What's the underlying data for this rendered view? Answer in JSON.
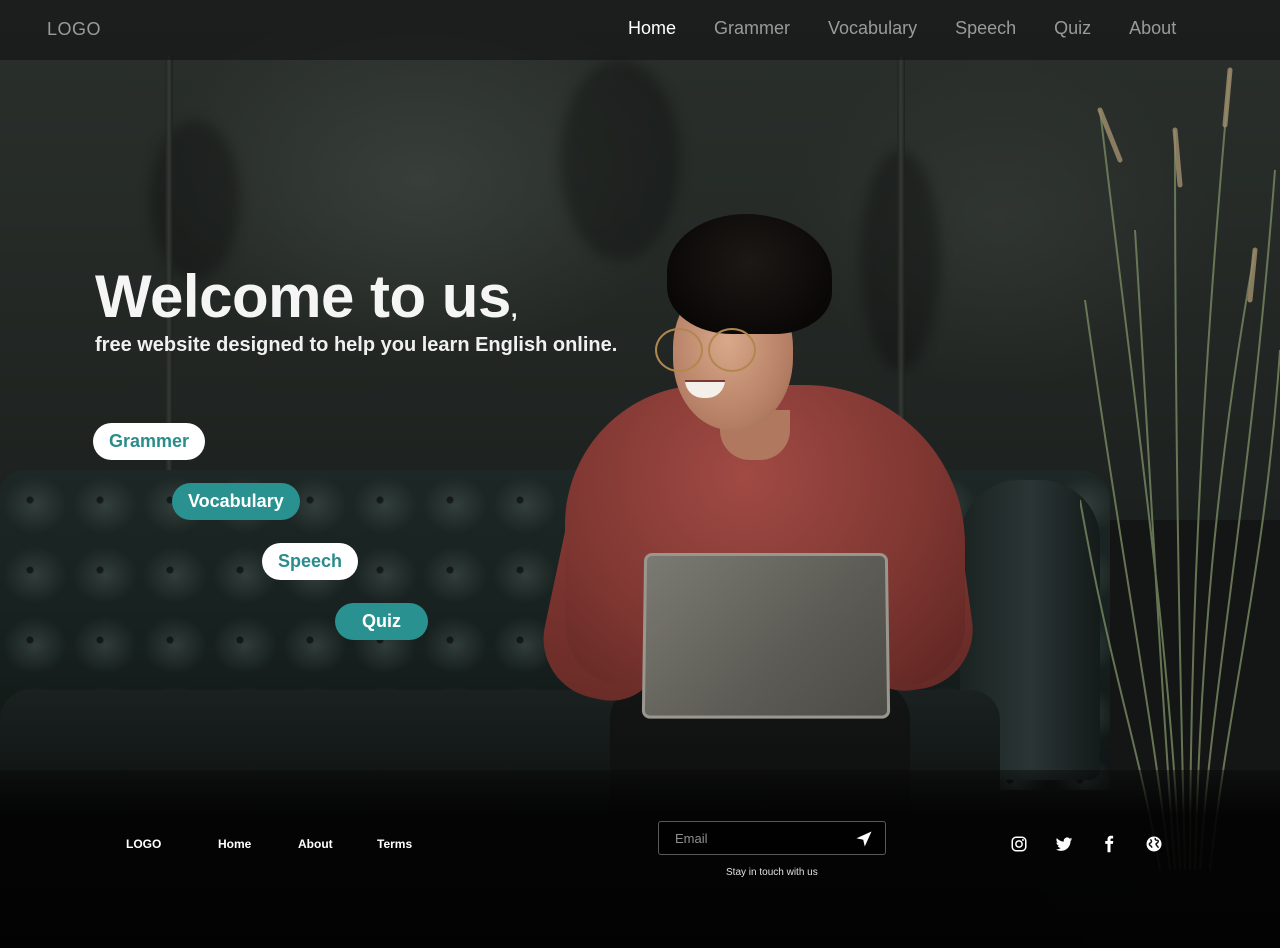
{
  "header": {
    "logo": "LOGO",
    "nav": [
      {
        "label": "Home",
        "active": true
      },
      {
        "label": "Grammer",
        "active": false
      },
      {
        "label": "Vocabulary",
        "active": false
      },
      {
        "label": "Speech",
        "active": false
      },
      {
        "label": "Quiz",
        "active": false
      },
      {
        "label": "About",
        "active": false
      }
    ]
  },
  "hero": {
    "title": "Welcome to us",
    "title_suffix": ",",
    "subtitle": "free website designed to help you learn English online.",
    "buttons": [
      {
        "label": "Grammer",
        "style": "light"
      },
      {
        "label": "Vocabulary",
        "style": "teal"
      },
      {
        "label": "Speech",
        "style": "light"
      },
      {
        "label": "Quiz",
        "style": "teal"
      }
    ]
  },
  "footer": {
    "logo": "LOGO",
    "links": [
      "Home",
      "About",
      "Terms"
    ],
    "email_placeholder": "Email",
    "stay_text": "Stay in touch with us",
    "social_icons": [
      "instagram-icon",
      "twitter-icon",
      "facebook-icon",
      "globe-icon"
    ]
  },
  "colors": {
    "accent": "#29918f",
    "nav_inactive": "#9a9a9a",
    "nav_active": "#ffffff"
  }
}
